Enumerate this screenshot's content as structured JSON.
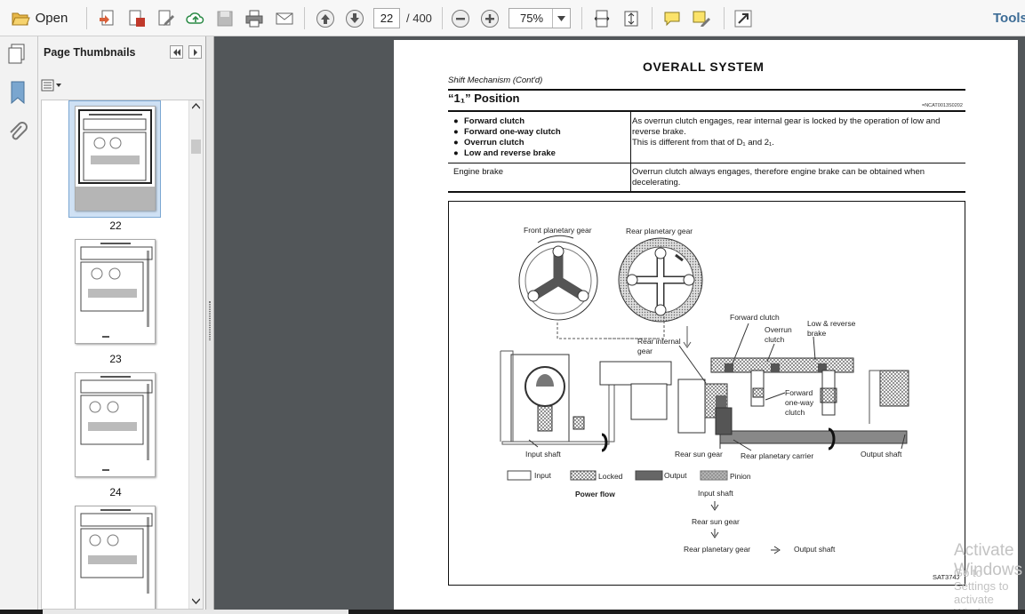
{
  "toolbar": {
    "open_label": "Open",
    "page_current": "22",
    "page_total": "/ 400",
    "zoom": "75%",
    "tools_label": "Tools"
  },
  "panel": {
    "title": "Page Thumbnails",
    "thumbnails": [
      {
        "num": "22",
        "selected": true
      },
      {
        "num": "23",
        "selected": false
      },
      {
        "num": "24",
        "selected": false
      },
      {
        "num": "",
        "selected": false
      }
    ]
  },
  "doc": {
    "title": "OVERALL SYSTEM",
    "subtitle": "Shift Mechanism (Cont'd)",
    "heading": "“1₁” Position",
    "code": "=NCAT0013S0202",
    "bullets": [
      "Forward clutch",
      "Forward one-way clutch",
      "Overrun clutch",
      "Low and reverse brake"
    ],
    "row1_desc1": "As overrun clutch engages, rear internal gear is locked by the operation of low and reverse brake.",
    "row1_desc2": "This is different from that of D₁ and 2₁.",
    "row2_label": "Engine brake",
    "row2_desc": "Overrun clutch always engages, therefore engine brake can be obtained when decelerating."
  },
  "figure": {
    "labels": {
      "front_planetary": "Front planetary gear",
      "rear_planetary": "Rear planetary gear",
      "forward_clutch": "Forward clutch",
      "overrun_clutch": "Overrun clutch",
      "low_reverse": "Low & reverse brake",
      "rear_internal": "Rear internal gear",
      "forward_oneway": "Forward one-way clutch",
      "input_shaft": "Input shaft",
      "rear_sun": "Rear sun gear",
      "rear_carrier": "Rear planetary carrier",
      "output_shaft": "Output shaft"
    },
    "legend": [
      "Input",
      "Locked",
      "Output",
      "Pinion"
    ],
    "power_flow_title": "Power flow",
    "flow": [
      "Input shaft",
      "Rear sun gear",
      "Rear planetary gear",
      "Output shaft"
    ],
    "fig_id": "SAT374J"
  },
  "watermark": {
    "line1": "Activate Windows",
    "line2": "Go to Settings to activate Windows."
  }
}
